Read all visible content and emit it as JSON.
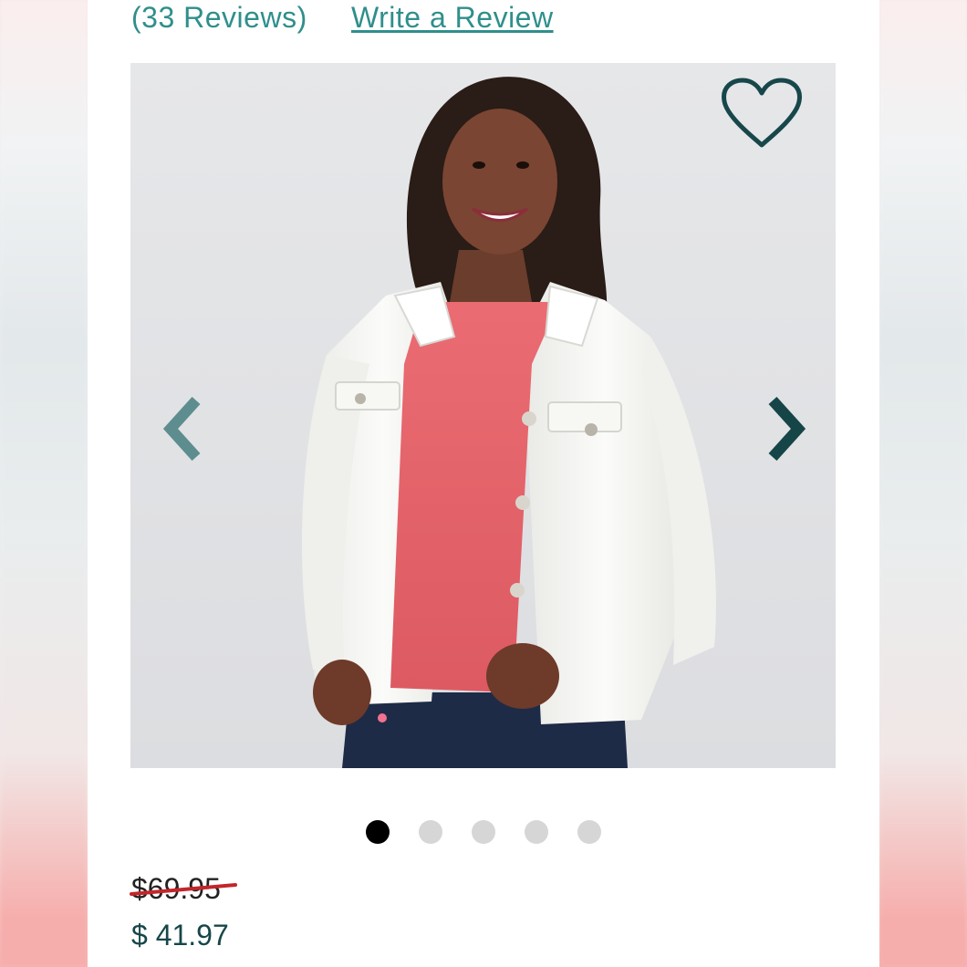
{
  "reviews": {
    "count_label": "(33 Reviews)",
    "write_label": "Write a Review"
  },
  "gallery": {
    "image_alt": "Woman wearing a white denim jacket over a coral t-shirt with dark jeans",
    "favorite_icon": "heart-outline-icon",
    "prev_icon": "chevron-left-icon",
    "next_icon": "chevron-right-icon",
    "slide_count": 5,
    "active_slide": 1
  },
  "pricing": {
    "original": "$69.95",
    "sale": "$ 41.97"
  },
  "colors": {
    "accent": "#2f8f8c",
    "price": "#17474a",
    "strike": "#c3252a",
    "dot_active": "#000000",
    "dot_inactive": "#d6d6d6"
  }
}
